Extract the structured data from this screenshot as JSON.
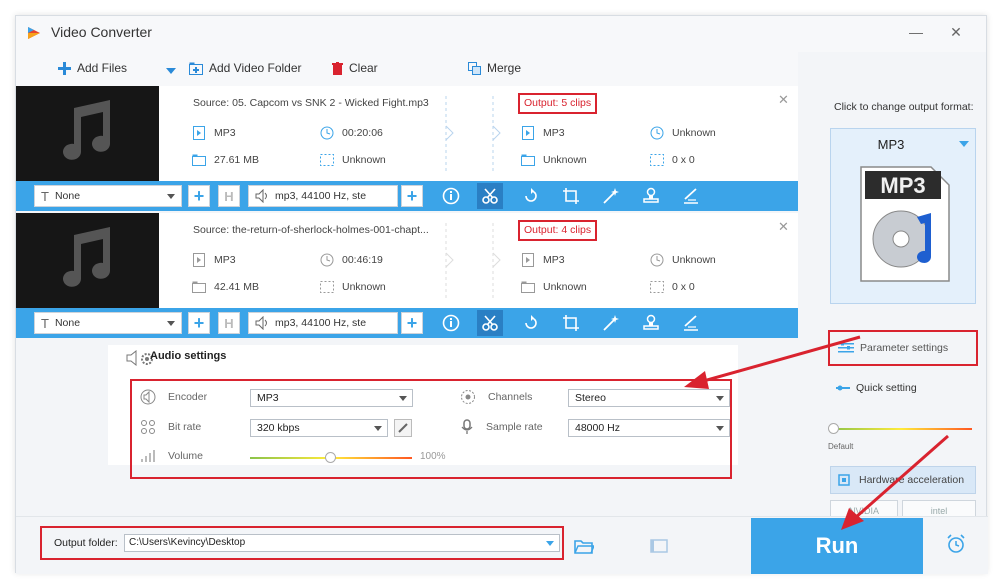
{
  "app": {
    "title": "Video Converter",
    "minimize": "—",
    "close": "✕"
  },
  "toolbar": {
    "add_files": "Add Files",
    "add_video_folder": "Add Video Folder",
    "clear": "Clear",
    "merge": "Merge"
  },
  "files": [
    {
      "source": "Source: 05. Capcom vs SNK 2 - Wicked Fight.mp3",
      "src_format": "MP3",
      "src_duration": "00:20:06",
      "src_size": "27.61 MB",
      "src_resolution": "Unknown",
      "output_badge": "Output: 5 clips",
      "out_format": "MP3",
      "out_duration": "Unknown",
      "out_size": "Unknown",
      "out_resolution": "0 x 0",
      "subtitle": "None",
      "audio_track": "mp3, 44100 Hz, ste"
    },
    {
      "source": "Source: the-return-of-sherlock-holmes-001-chapt...",
      "src_format": "MP3",
      "src_duration": "00:46:19",
      "src_size": "42.41 MB",
      "src_resolution": "Unknown",
      "output_badge": "Output: 4 clips",
      "out_format": "MP3",
      "out_duration": "Unknown",
      "out_size": "Unknown",
      "out_resolution": "0 x 0",
      "subtitle": "None",
      "audio_track": "mp3, 44100 Hz, ste"
    }
  ],
  "audio_settings": {
    "title": "Audio settings",
    "encoder_label": "Encoder",
    "encoder_value": "MP3",
    "bitrate_label": "Bit rate",
    "bitrate_value": "320 kbps",
    "volume_label": "Volume",
    "volume_value": "100%",
    "channels_label": "Channels",
    "channels_value": "Stereo",
    "samplerate_label": "Sample rate",
    "samplerate_value": "48000 Hz"
  },
  "right_panel": {
    "click_label": "Click to change output format:",
    "format_name": "MP3",
    "format_icon_text": "MP3",
    "parameter_settings": "Parameter settings",
    "quick_setting": "Quick setting",
    "default_label": "Default",
    "hardware_acceleration": "Hardware acceleration",
    "nvidia": "NVIDIA",
    "intel": "intel"
  },
  "bottom": {
    "output_folder_label": "Output folder:",
    "output_folder_value": "C:\\Users\\Kevincy\\Desktop",
    "run_label": "Run"
  },
  "colors": {
    "accent": "#3ba4e8",
    "highlight": "#d9232f"
  }
}
